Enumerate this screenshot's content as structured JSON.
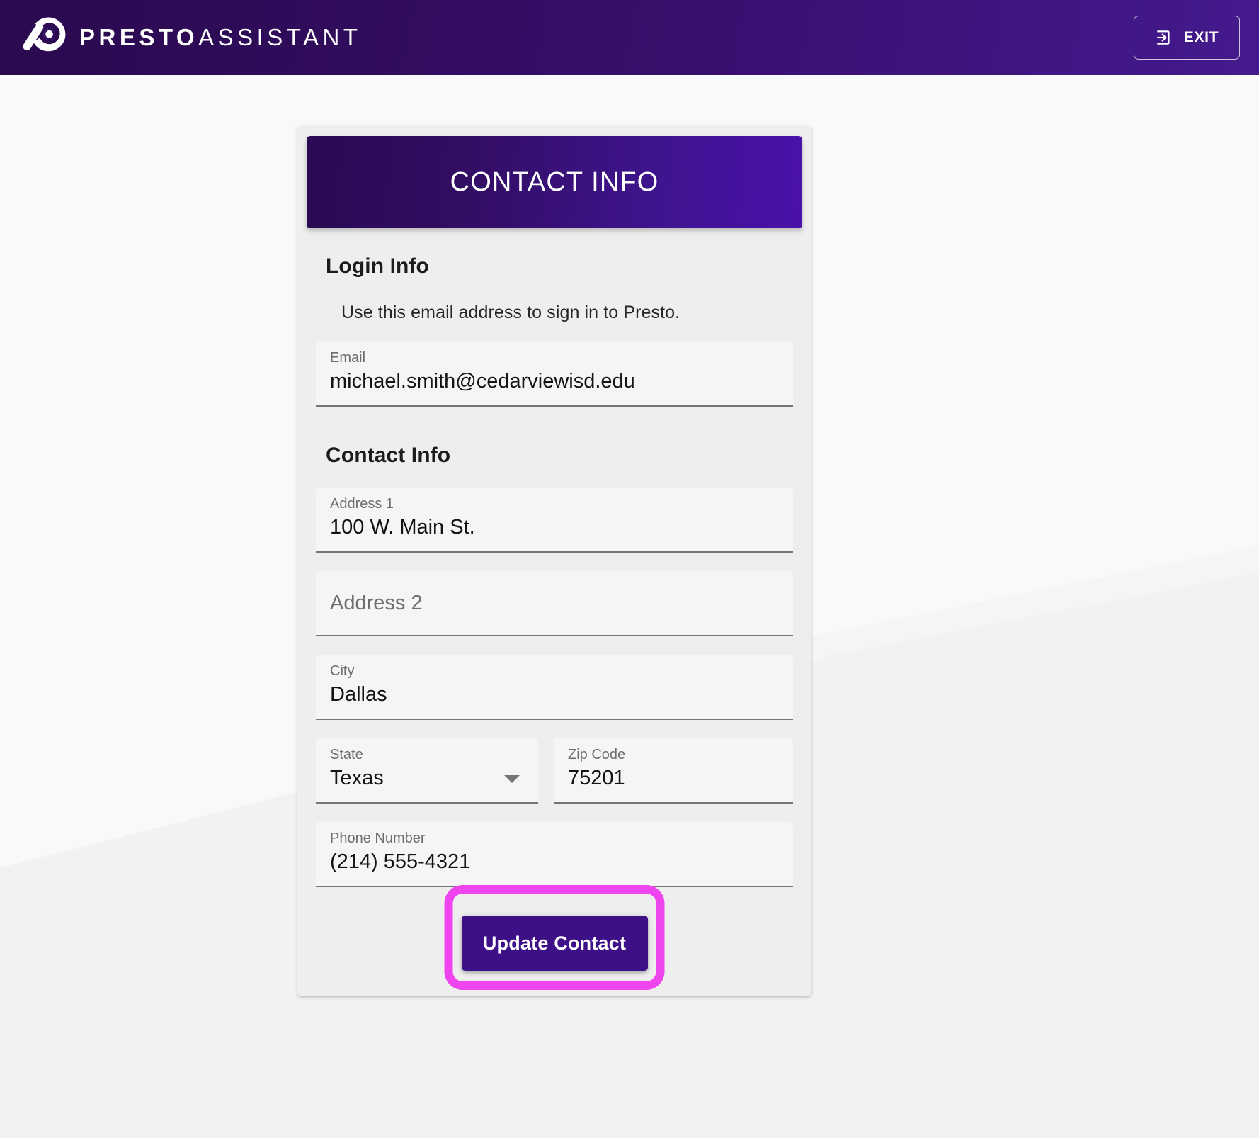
{
  "header": {
    "brand_bold": "PRESTO",
    "brand_light": "ASSISTANT",
    "logo_icon": "presto-logo-icon",
    "exit": {
      "label": "EXIT",
      "icon": "exit-door-arrow-icon"
    },
    "colors": {
      "bar_start": "#2b0a4f",
      "bar_end": "#441a8e"
    }
  },
  "card": {
    "title": "CONTACT INFO",
    "header_gradient_start": "#2a0a52",
    "header_gradient_end": "#4a11aa",
    "sections": {
      "login": {
        "heading": "Login Info",
        "helper": "Use this email address to sign in to Presto.",
        "email_field": {
          "label": "Email",
          "value": "michael.smith@cedarviewisd.edu"
        }
      },
      "contact": {
        "heading": "Contact Info",
        "address1": {
          "label": "Address 1",
          "value": "100 W. Main St."
        },
        "address2": {
          "label": "Address 2",
          "value": "",
          "placeholder": "Address 2"
        },
        "city": {
          "label": "City",
          "value": "Dallas"
        },
        "state": {
          "label": "State",
          "value": "Texas",
          "icon": "chevron-down-icon"
        },
        "zip": {
          "label": "Zip Code",
          "value": "75201"
        },
        "phone": {
          "label": "Phone Number",
          "value": "(214) 555-4321"
        }
      }
    },
    "actions": {
      "update_label": "Update Contact",
      "update_color": "#3d1088",
      "highlight_color": "#ee45ee"
    }
  },
  "background": {
    "upper_color": "#f7f8fa",
    "lower_color": "#f2f2f2"
  }
}
